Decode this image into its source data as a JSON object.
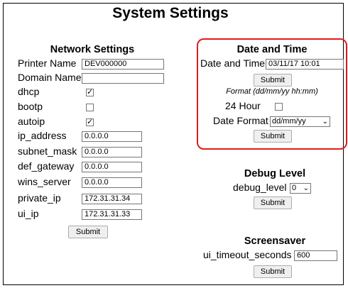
{
  "page_title": "System Settings",
  "network": {
    "title": "Network Settings",
    "printer_name": {
      "label": "Printer Name",
      "value": "DEV000000"
    },
    "domain_name": {
      "label": "Domain Name",
      "value": ""
    },
    "dhcp": {
      "label": "dhcp",
      "checked": true
    },
    "bootp": {
      "label": "bootp",
      "checked": false
    },
    "autoip": {
      "label": "autoip",
      "checked": true
    },
    "ip_address": {
      "label": "ip_address",
      "value": "0.0.0.0"
    },
    "subnet_mask": {
      "label": "subnet_mask",
      "value": "0.0.0.0"
    },
    "def_gateway": {
      "label": "def_gateway",
      "value": "0.0.0.0"
    },
    "wins_server": {
      "label": "wins_server",
      "value": "0.0.0.0"
    },
    "private_ip": {
      "label": "private_ip",
      "value": "172.31.31.34"
    },
    "ui_ip": {
      "label": "ui_ip",
      "value": "172.31.31.33"
    },
    "submit": "Submit"
  },
  "datetime": {
    "title": "Date and Time",
    "label": "Date and Time",
    "value": "03/11/17 10:01",
    "submit": "Submit",
    "format_hint": "Format (dd/mm/yy hh:mm)",
    "hour24": {
      "label": "24 Hour",
      "checked": false
    },
    "date_format": {
      "label": "Date Format",
      "value": "dd/mm/yy"
    },
    "submit2": "Submit"
  },
  "debug": {
    "title": "Debug Level",
    "label": "debug_level",
    "value": "0",
    "submit": "Submit"
  },
  "screensaver": {
    "title": "Screensaver",
    "label": "ui_timeout_seconds",
    "value": "600",
    "submit": "Submit"
  },
  "check_mark": "✓",
  "chevron": "⌄",
  "accent_color": "#e31b1b"
}
